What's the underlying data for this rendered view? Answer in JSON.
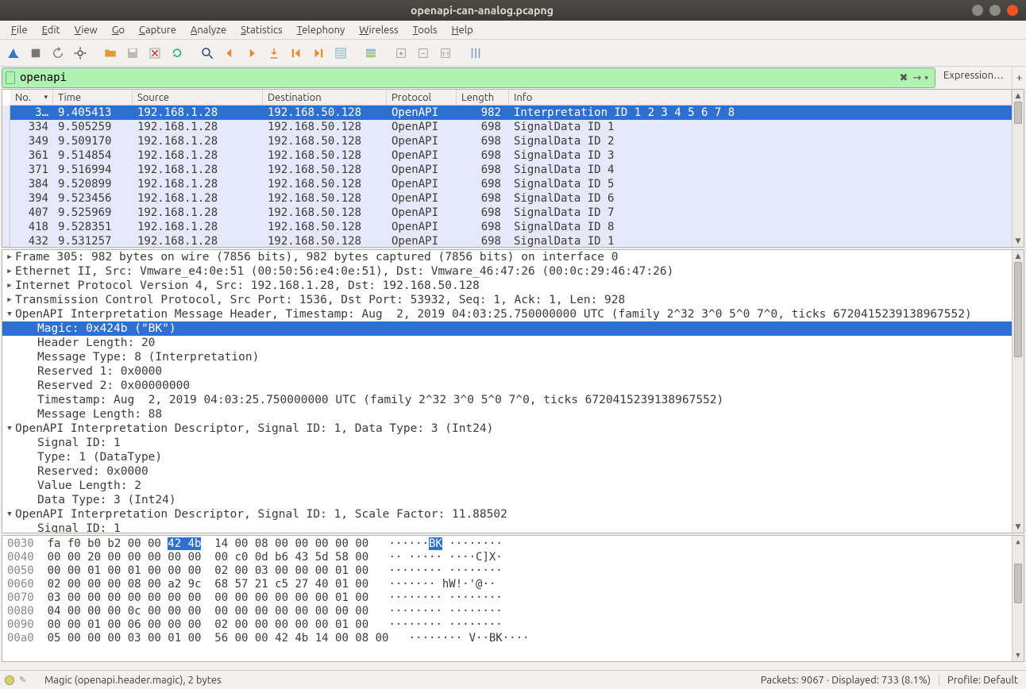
{
  "window": {
    "title": "openapi-can-analog.pcapng"
  },
  "menus": [
    "File",
    "Edit",
    "View",
    "Go",
    "Capture",
    "Analyze",
    "Statistics",
    "Telephony",
    "Wireless",
    "Tools",
    "Help"
  ],
  "filter": {
    "value": "openapi",
    "expression_label": "Expression…"
  },
  "columns": {
    "no": "No.",
    "time": "Time",
    "source": "Source",
    "destination": "Destination",
    "protocol": "Protocol",
    "length": "Length",
    "info": "Info"
  },
  "packets": [
    {
      "no": "3…",
      "time": "9.405413",
      "src": "192.168.1.28",
      "dst": "192.168.50.128",
      "proto": "OpenAPI",
      "len": "982",
      "info": "Interpretation ID 1 2 3 4 5 6 7 8",
      "selected": true
    },
    {
      "no": "334",
      "time": "9.505259",
      "src": "192.168.1.28",
      "dst": "192.168.50.128",
      "proto": "OpenAPI",
      "len": "698",
      "info": "SignalData ID 1"
    },
    {
      "no": "349",
      "time": "9.509170",
      "src": "192.168.1.28",
      "dst": "192.168.50.128",
      "proto": "OpenAPI",
      "len": "698",
      "info": "SignalData ID 2"
    },
    {
      "no": "361",
      "time": "9.514854",
      "src": "192.168.1.28",
      "dst": "192.168.50.128",
      "proto": "OpenAPI",
      "len": "698",
      "info": "SignalData ID 3"
    },
    {
      "no": "371",
      "time": "9.516994",
      "src": "192.168.1.28",
      "dst": "192.168.50.128",
      "proto": "OpenAPI",
      "len": "698",
      "info": "SignalData ID 4"
    },
    {
      "no": "384",
      "time": "9.520899",
      "src": "192.168.1.28",
      "dst": "192.168.50.128",
      "proto": "OpenAPI",
      "len": "698",
      "info": "SignalData ID 5"
    },
    {
      "no": "394",
      "time": "9.523456",
      "src": "192.168.1.28",
      "dst": "192.168.50.128",
      "proto": "OpenAPI",
      "len": "698",
      "info": "SignalData ID 6"
    },
    {
      "no": "407",
      "time": "9.525969",
      "src": "192.168.1.28",
      "dst": "192.168.50.128",
      "proto": "OpenAPI",
      "len": "698",
      "info": "SignalData ID 7"
    },
    {
      "no": "418",
      "time": "9.528351",
      "src": "192.168.1.28",
      "dst": "192.168.50.128",
      "proto": "OpenAPI",
      "len": "698",
      "info": "SignalData ID 8"
    },
    {
      "no": "432",
      "time": "9.531257",
      "src": "192.168.1.28",
      "dst": "192.168.50.128",
      "proto": "OpenAPI",
      "len": "698",
      "info": "SignalData ID 1"
    }
  ],
  "details": [
    {
      "lvl": 0,
      "caret": "collapsed",
      "text": "Frame 305: 982 bytes on wire (7856 bits), 982 bytes captured (7856 bits) on interface 0"
    },
    {
      "lvl": 0,
      "caret": "collapsed",
      "text": "Ethernet II, Src: Vmware_e4:0e:51 (00:50:56:e4:0e:51), Dst: Vmware_46:47:26 (00:0c:29:46:47:26)"
    },
    {
      "lvl": 0,
      "caret": "collapsed",
      "text": "Internet Protocol Version 4, Src: 192.168.1.28, Dst: 192.168.50.128"
    },
    {
      "lvl": 0,
      "caret": "collapsed",
      "text": "Transmission Control Protocol, Src Port: 1536, Dst Port: 53932, Seq: 1, Ack: 1, Len: 928"
    },
    {
      "lvl": 0,
      "caret": "expanded",
      "text": "OpenAPI Interpretation Message Header, Timestamp: Aug  2, 2019 04:03:25.750000000 UTC (family 2^32 3^0 5^0 7^0, ticks 6720415239138967552)"
    },
    {
      "lvl": 2,
      "caret": "none",
      "selected": true,
      "text": "Magic: 0x424b (\"BK\")"
    },
    {
      "lvl": 2,
      "caret": "none",
      "text": "Header Length: 20"
    },
    {
      "lvl": 2,
      "caret": "none",
      "text": "Message Type: 8 (Interpretation)"
    },
    {
      "lvl": 2,
      "caret": "none",
      "text": "Reserved 1: 0x0000"
    },
    {
      "lvl": 2,
      "caret": "none",
      "text": "Reserved 2: 0x00000000"
    },
    {
      "lvl": 2,
      "caret": "none",
      "text": "Timestamp: Aug  2, 2019 04:03:25.750000000 UTC (family 2^32 3^0 5^0 7^0, ticks 6720415239138967552)"
    },
    {
      "lvl": 2,
      "caret": "none",
      "text": "Message Length: 88"
    },
    {
      "lvl": 0,
      "caret": "expanded",
      "text": "OpenAPI Interpretation Descriptor, Signal ID: 1, Data Type: 3 (Int24)"
    },
    {
      "lvl": 2,
      "caret": "none",
      "text": "Signal ID: 1"
    },
    {
      "lvl": 2,
      "caret": "none",
      "text": "Type: 1 (DataType)"
    },
    {
      "lvl": 2,
      "caret": "none",
      "text": "Reserved: 0x0000"
    },
    {
      "lvl": 2,
      "caret": "none",
      "text": "Value Length: 2"
    },
    {
      "lvl": 2,
      "caret": "none",
      "text": "Data Type: 3 (Int24)"
    },
    {
      "lvl": 0,
      "caret": "expanded",
      "text": "OpenAPI Interpretation Descriptor, Signal ID: 1, Scale Factor: 11.88502"
    },
    {
      "lvl": 2,
      "caret": "none",
      "text": "Signal ID: 1"
    }
  ],
  "hex": [
    {
      "off": "0030",
      "b1": "fa f0 b0 b2 00 00 ",
      "hl": "42 4b",
      "b2": "  14 00 08 00 00 00 00 00",
      "asc1": "   ······",
      "aschl": "BK",
      "asc2": " ········"
    },
    {
      "off": "0040",
      "b1": "00 00 20 00 00 00 00 00  00 c0 0d b6 43 5d 58 00",
      "asc": "   ·· ····· ····C]X·"
    },
    {
      "off": "0050",
      "b1": "00 00 01 00 01 00 00 00  02 00 03 00 00 00 01 00",
      "asc": "   ········ ········"
    },
    {
      "off": "0060",
      "b1": "02 00 00 00 08 00 a2 9c  68 57 21 c5 27 40 01 00",
      "asc": "   ······· hW!·'@··"
    },
    {
      "off": "0070",
      "b1": "03 00 00 00 00 00 00 00  00 00 00 00 00 00 01 00",
      "asc": "   ········ ········"
    },
    {
      "off": "0080",
      "b1": "04 00 00 00 0c 00 00 00  00 00 00 00 00 00 00 00",
      "asc": "   ········ ········"
    },
    {
      "off": "0090",
      "b1": "00 00 01 00 06 00 00 00  02 00 00 00 00 00 01 00",
      "asc": "   ········ ········"
    },
    {
      "off": "00a0",
      "b1": "05 00 00 00 03 00 01 00  56 00 00 42 4b 14 00 08 00",
      "asc": "   ········ V··BK····"
    }
  ],
  "status": {
    "field": "Magic (openapi.header.magic), 2 bytes",
    "packets": "Packets: 9067 · Displayed: 733 (8.1%)",
    "profile": "Profile: Default"
  },
  "icons": {
    "fin": "shark-fin-icon",
    "stop": "stop-icon",
    "restart": "restart-icon",
    "options": "gear-icon",
    "open": "folder-open-icon",
    "save": "save-icon",
    "close": "close-file-icon",
    "reload": "reload-icon",
    "find": "search-icon",
    "back": "back-icon",
    "fwd": "forward-icon",
    "jump": "jump-icon",
    "first": "goto-first-icon",
    "last": "goto-last-icon",
    "autoscroll": "autoscroll-icon",
    "colorize": "colorize-icon",
    "zoomin": "zoom-in-icon",
    "zoomout": "zoom-out-icon",
    "zoom100": "zoom-reset-icon",
    "resize": "resize-columns-icon"
  }
}
